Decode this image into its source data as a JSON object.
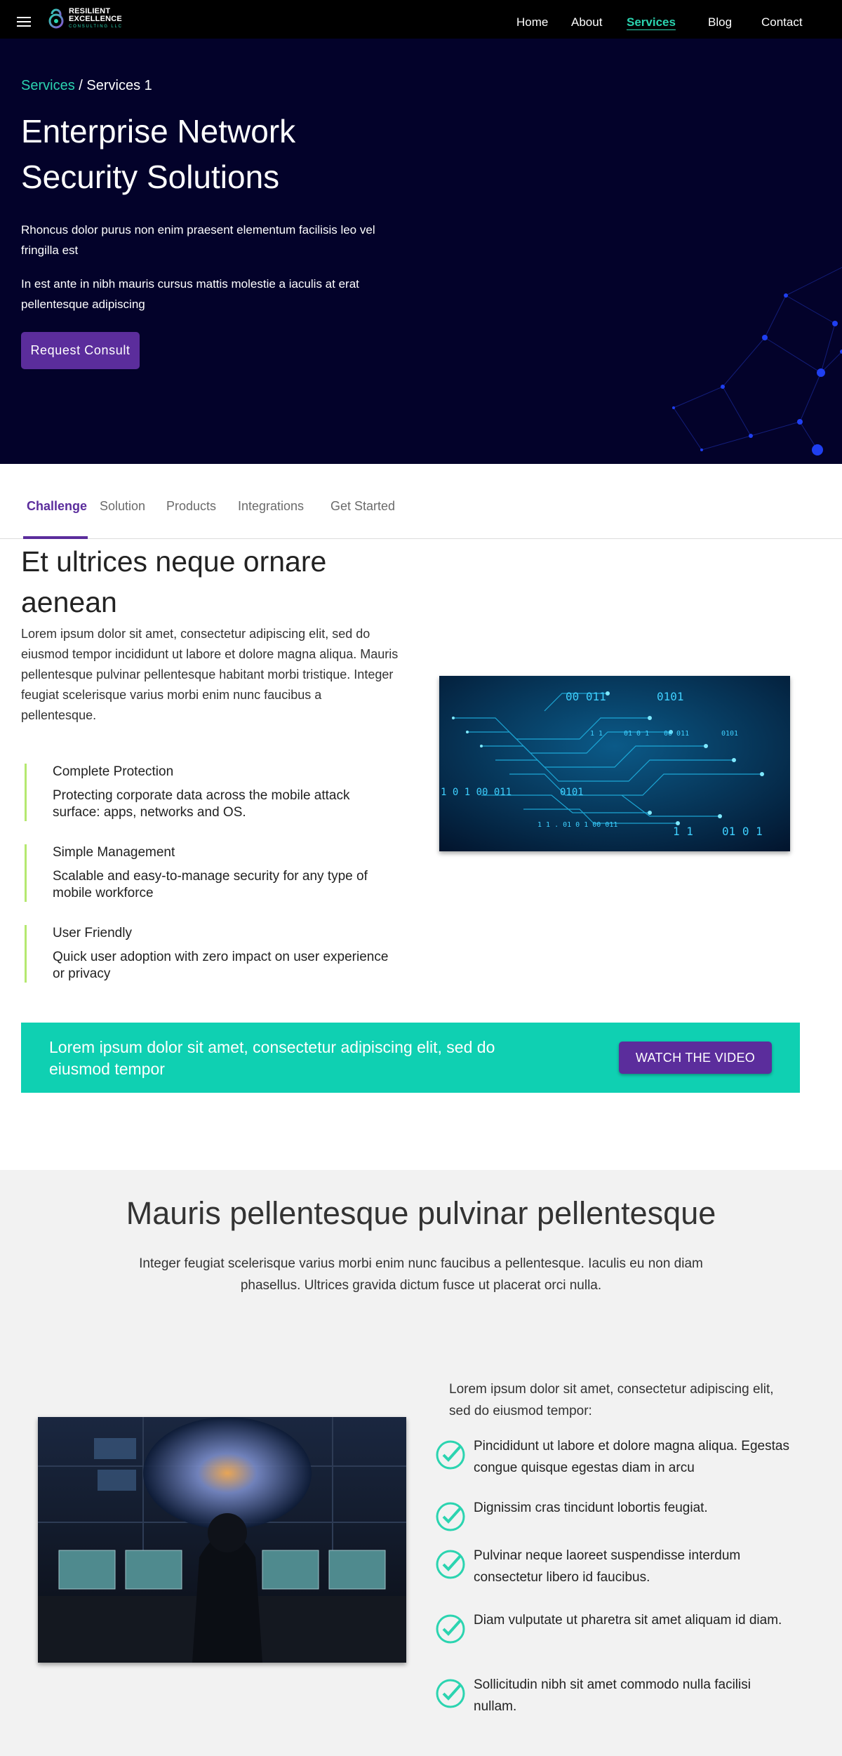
{
  "nav": {
    "logo": {
      "line1": "RESILIENT",
      "line2": "EXCELLENCE",
      "line3": "CONSULTING LLC"
    },
    "links": [
      "Home",
      "About",
      "Services",
      "Blog",
      "Contact"
    ],
    "active": "Services"
  },
  "hero": {
    "breadcrumb": {
      "link": "Services",
      "separator": " / ",
      "current": "Services 1"
    },
    "title": "Enterprise Network Security Solutions",
    "p1": "Rhoncus dolor purus non enim praesent elementum facilisis leo vel fringilla est",
    "p2": "In est ante in nibh mauris cursus mattis molestie a iaculis at erat pellentesque adipiscing",
    "cta": "Request Consult"
  },
  "tabs": {
    "items": [
      "Challenge",
      "Solution",
      "Products",
      "Integrations",
      "Get Started"
    ],
    "active": "Challenge"
  },
  "challenge": {
    "title": "Et ultrices neque ornare aenean",
    "body": "Lorem ipsum dolor sit amet, consectetur adipiscing elit, sed do eiusmod tempor incididunt ut labore et dolore magna aliqua. Mauris pellentesque pulvinar pellentesque habitant morbi tristique. Integer feugiat scelerisque varius morbi enim nunc faucibus a pellentesque.",
    "features": [
      {
        "title": "Complete Protection",
        "text": "Protecting corporate data across the mobile attack surface: apps, networks and OS."
      },
      {
        "title": "Simple Management",
        "text": "Scalable and easy-to-manage security for any type of mobile workforce"
      },
      {
        "title": "User Friendly",
        "text": "Quick user adoption with zero impact on user experience or privacy"
      }
    ],
    "image_digits": [
      "00 011",
      "0101",
      "1 1",
      "01 0 1",
      "00 011",
      "0101",
      "1 0 1 00 011",
      "0101",
      "1 1 . 01 0 1 00 011",
      "1 1",
      "01 0 1"
    ]
  },
  "cta_banner": {
    "text": "Lorem ipsum dolor sit amet, consectetur adipiscing elit, sed do eiusmod tempor",
    "button": "WATCH THE VIDEO"
  },
  "section2": {
    "title": "Mauris pellentesque pulvinar pellentesque",
    "subtitle": "Integer feugiat scelerisque varius morbi enim nunc faucibus a pellentesque. Iaculis eu non diam phasellus. Ultrices gravida dictum fusce ut placerat orci nulla.",
    "list_intro": "Lorem ipsum dolor sit amet, consectetur adipiscing elit, sed do eiusmod tempor:",
    "items": [
      "Pincididunt ut labore et dolore magna aliqua. Egestas congue quisque egestas diam in arcu",
      "Dignissim cras tincidunt lobortis feugiat.",
      "Pulvinar neque laoreet suspendisse interdum consectetur libero id faucibus.",
      "Diam vulputate ut pharetra sit amet aliquam id diam.",
      "Sollicitudin nibh sit amet commodo nulla facilisi nullam."
    ]
  },
  "colors": {
    "accent_teal": "#2bd4b0",
    "brand_purple": "#5b2d9c",
    "hero_bg": "#03022a",
    "cta_teal": "#0fd0b2",
    "feature_border": "#b5e86f"
  }
}
